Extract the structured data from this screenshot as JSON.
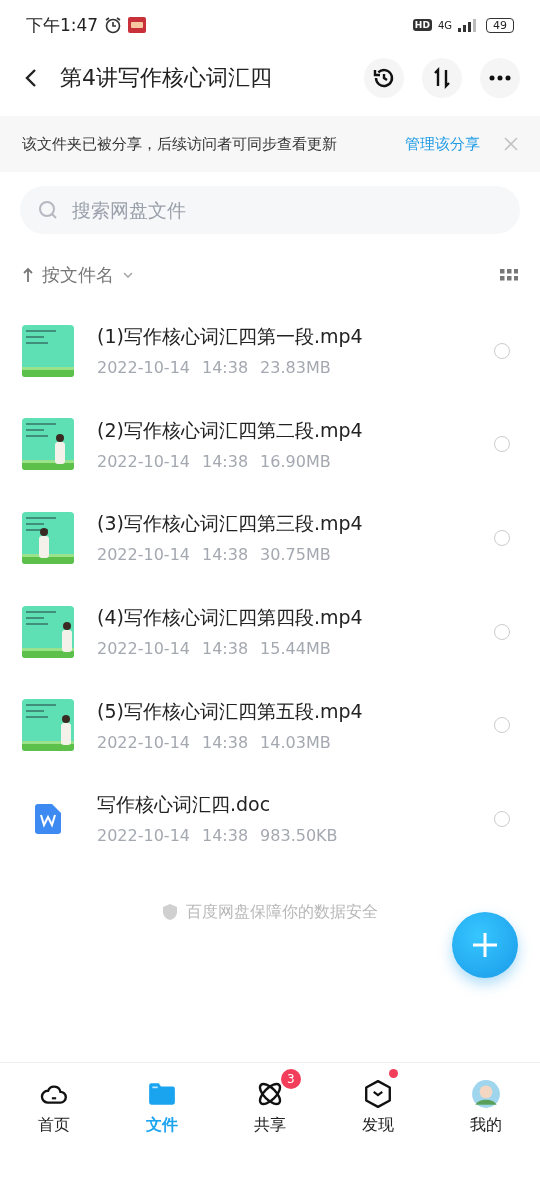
{
  "status_bar": {
    "time": "下午1:47",
    "network": "4G",
    "hd": "HD",
    "battery": "49"
  },
  "header": {
    "title": "第4讲写作核心词汇四"
  },
  "share_banner": {
    "message": "该文件夹已被分享，后续访问者可同步查看更新",
    "action": "管理该分享"
  },
  "search": {
    "placeholder": "搜索网盘文件"
  },
  "sort": {
    "label": "按文件名"
  },
  "files": [
    {
      "kind": "video",
      "name": "(1)写作核心词汇四第一段.mp4",
      "date": "2022-10-14",
      "time": "14:38",
      "size": "23.83MB",
      "checked": false
    },
    {
      "kind": "video",
      "name": "(2)写作核心词汇四第二段.mp4",
      "date": "2022-10-14",
      "time": "14:38",
      "size": "16.90MB",
      "checked": false
    },
    {
      "kind": "video",
      "name": "(3)写作核心词汇四第三段.mp4",
      "date": "2022-10-14",
      "time": "14:38",
      "size": "30.75MB",
      "checked": false
    },
    {
      "kind": "video",
      "name": "(4)写作核心词汇四第四段.mp4",
      "date": "2022-10-14",
      "time": "14:38",
      "size": "15.44MB",
      "checked": false
    },
    {
      "kind": "video",
      "name": "(5)写作核心词汇四第五段.mp4",
      "date": "2022-10-14",
      "time": "14:38",
      "size": "14.03MB",
      "checked": false
    },
    {
      "kind": "doc",
      "name": "写作核心词汇四.doc",
      "date": "2022-10-14",
      "time": "14:38",
      "size": "983.50KB",
      "checked": false
    }
  ],
  "footer_note": "百度网盘保障你的数据安全",
  "tabs": [
    {
      "kind": "home",
      "label": "首页",
      "selected": false
    },
    {
      "kind": "files",
      "label": "文件",
      "selected": true
    },
    {
      "kind": "share",
      "label": "共享",
      "selected": false,
      "badge": "3"
    },
    {
      "kind": "discover",
      "label": "发现",
      "selected": false,
      "dot": true
    },
    {
      "kind": "me",
      "label": "我的",
      "selected": false
    }
  ]
}
